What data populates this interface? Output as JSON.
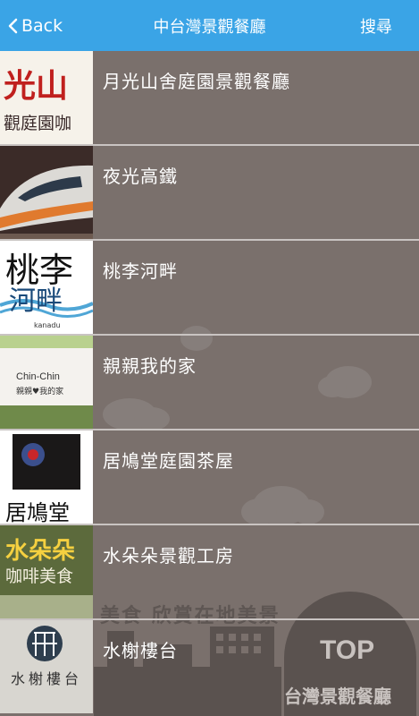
{
  "navbar": {
    "back_label": "Back",
    "title": "中台灣景觀餐廳",
    "search_label": "搜尋"
  },
  "restaurants": [
    {
      "name": "月光山舍庭園景觀餐廳",
      "thumb_text_top": "光山",
      "thumb_text_bottom": "觀庭園咖"
    },
    {
      "name": "夜光高鐵"
    },
    {
      "name": "桃李河畔",
      "thumb_text_top": "桃李",
      "thumb_text_mid": "河畔",
      "thumb_text_small": "kanadu"
    },
    {
      "name": "親親我的家",
      "thumb_text_top": "Chin-Chin",
      "thumb_text_bottom": "親親♥我的家"
    },
    {
      "name": "居鳩堂庭園茶屋",
      "thumb_text_bottom": "居鳩堂"
    },
    {
      "name": "水朵朵景觀工房",
      "thumb_text_top": "水朵朵",
      "thumb_text_bottom": "咖啡美食"
    },
    {
      "name": "水榭樓台",
      "thumb_text_bottom": "水榭樓台"
    }
  ],
  "background": {
    "banner_text": "美食 欣賞在地美景",
    "top_badge": "TOP",
    "brand_text": "台灣景觀餐廳"
  },
  "colors": {
    "navbar": "#3aa4e6",
    "list_bg": "#7a706c",
    "divider": "#c9c4c2"
  }
}
